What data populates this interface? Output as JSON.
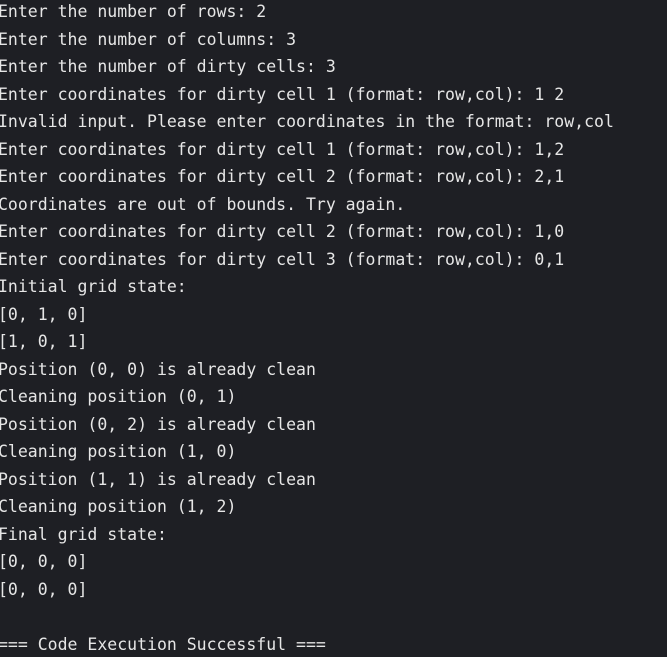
{
  "output": {
    "lines": [
      "Enter the number of rows: 2",
      "Enter the number of columns: 3",
      "Enter the number of dirty cells: 3",
      "Enter coordinates for dirty cell 1 (format: row,col): 1 2",
      "Invalid input. Please enter coordinates in the format: row,col",
      "Enter coordinates for dirty cell 1 (format: row,col): 1,2",
      "Enter coordinates for dirty cell 2 (format: row,col): 2,1",
      "Coordinates are out of bounds. Try again.",
      "Enter coordinates for dirty cell 2 (format: row,col): 1,0",
      "Enter coordinates for dirty cell 3 (format: row,col): 0,1",
      "Initial grid state:",
      "[0, 1, 0]",
      "[1, 0, 1]",
      "Position (0, 0) is already clean",
      "Cleaning position (0, 1)",
      "Position (0, 2) is already clean",
      "Cleaning position (1, 0)",
      "Position (1, 1) is already clean",
      "Cleaning position (1, 2)",
      "Final grid state:",
      "[0, 0, 0]",
      "[0, 0, 0]",
      "",
      "=== Code Execution Successful ==="
    ]
  },
  "colors": {
    "background": "#1e1f24",
    "text": "#e6e6e6"
  }
}
